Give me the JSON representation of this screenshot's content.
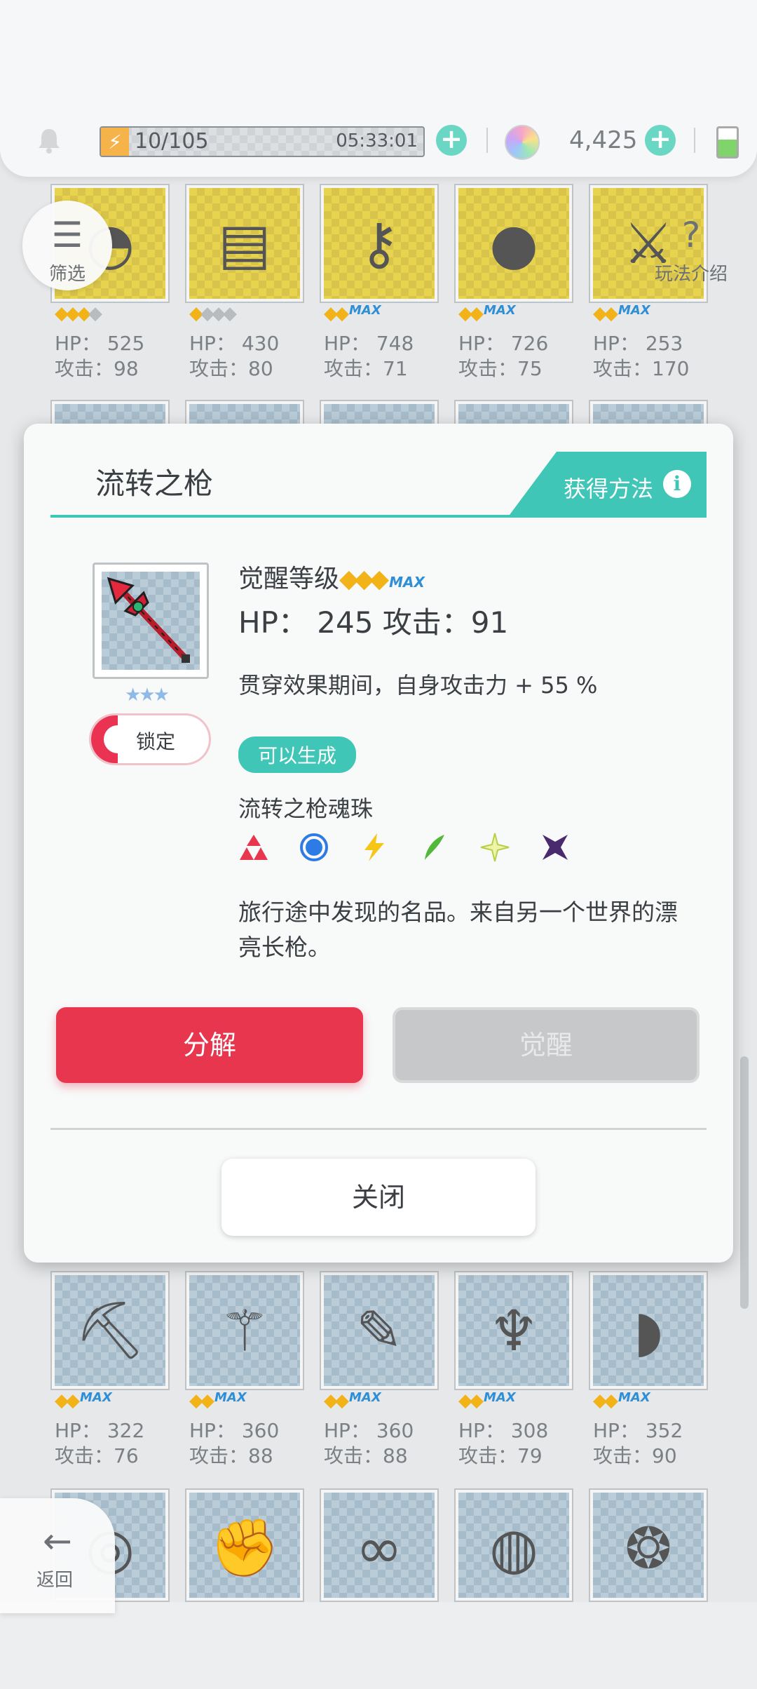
{
  "status_bar": {
    "stamina": "10/105",
    "timer": "05:33:01",
    "gems": "4,425"
  },
  "floating": {
    "filter_label": "筛选",
    "help_label": "玩法介绍",
    "back_label": "返回"
  },
  "grid_row1": [
    {
      "hp": "HP： 525",
      "atk": "攻击：98",
      "gold": 3,
      "grey": 1,
      "max": false
    },
    {
      "hp": "HP： 430",
      "atk": "攻击：80",
      "gold": 1,
      "grey": 3,
      "max": false
    },
    {
      "hp": "HP： 748",
      "atk": "攻击：71",
      "gold": 2,
      "grey": 0,
      "max": true
    },
    {
      "hp": "HP： 726",
      "atk": "攻击：75",
      "gold": 2,
      "grey": 0,
      "max": true
    },
    {
      "hp": "HP： 253",
      "atk": "攻击：170",
      "gold": 2,
      "grey": 0,
      "max": true
    }
  ],
  "grid_row3": [
    {
      "hp": "HP： 322",
      "atk": "攻击：76",
      "gold": 2,
      "grey": 0,
      "max": true
    },
    {
      "hp": "HP： 360",
      "atk": "攻击：88",
      "gold": 2,
      "grey": 0,
      "max": true
    },
    {
      "hp": "HP： 360",
      "atk": "攻击：88",
      "gold": 2,
      "grey": 0,
      "max": true
    },
    {
      "hp": "HP： 308",
      "atk": "攻击：79",
      "gold": 2,
      "grey": 0,
      "max": true
    },
    {
      "hp": "HP： 352",
      "atk": "攻击：90",
      "gold": 2,
      "grey": 0,
      "max": true
    }
  ],
  "max_tag": "MAX",
  "modal": {
    "title": "流转之枪",
    "obtain_label": "获得方法",
    "lock_label": "锁定",
    "level_label": "觉醒等级",
    "stats": "HP： 245   攻击：91",
    "effect": "贯穿效果期间，自身攻击力 + 55 %",
    "craftable": "可以生成",
    "soul_label": "流转之枪魂珠",
    "description": "旅行途中发现的名品。来自另一个世界的漂亮长枪。",
    "decompose_label": "分解",
    "awaken_label": "觉醒",
    "close_label": "关闭"
  },
  "elements": [
    "fire",
    "water",
    "thunder",
    "wind",
    "light",
    "dark"
  ],
  "colors": {
    "accent": "#3fc6b7",
    "danger": "#e9364f",
    "gem_gold": "#f2b318"
  }
}
